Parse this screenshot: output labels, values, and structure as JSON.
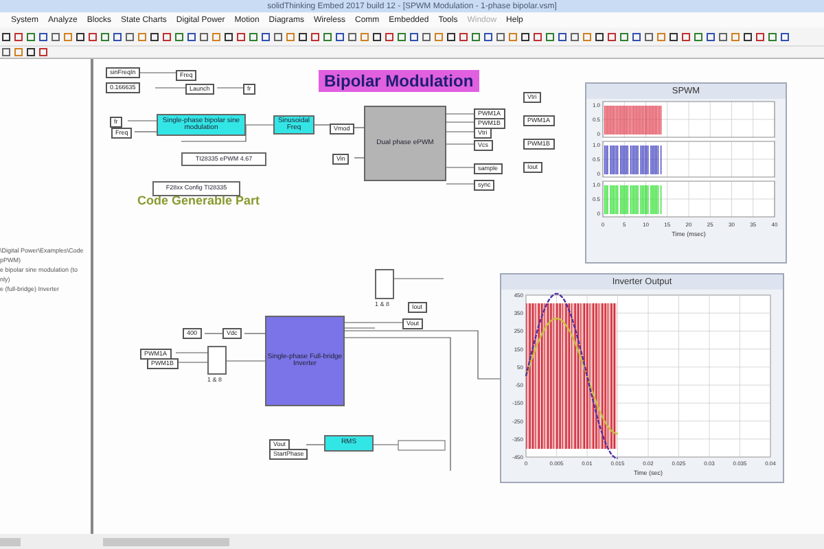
{
  "window": {
    "title": "solidThinking Embed 2017 build 12 - [SPWM Modulation - 1-phase bipolar.vsm]"
  },
  "menu": [
    {
      "label": "System",
      "disabled": false
    },
    {
      "label": "Analyze",
      "disabled": false
    },
    {
      "label": "Blocks",
      "disabled": false
    },
    {
      "label": "State Charts",
      "disabled": false
    },
    {
      "label": "Digital Power",
      "disabled": false
    },
    {
      "label": "Motion",
      "disabled": false
    },
    {
      "label": "Diagrams",
      "disabled": false
    },
    {
      "label": "Wireless",
      "disabled": false
    },
    {
      "label": "Comm",
      "disabled": false
    },
    {
      "label": "Embedded",
      "disabled": false
    },
    {
      "label": "Tools",
      "disabled": false
    },
    {
      "label": "Window",
      "disabled": true
    },
    {
      "label": "Help",
      "disabled": false
    }
  ],
  "left_panel": {
    "lines": [
      "\\Digital Power\\Examples\\Code",
      "pPWM)",
      "e bipolar sine modulation (to",
      "nly)",
      "e (full-bridge) Inverter"
    ]
  },
  "diagram": {
    "title": "Bipolar Modulation",
    "caption": "Code Generable Part",
    "blocks": [
      {
        "kind": "block",
        "text": "Single-phase bipolar sine modulation",
        "color": "#33e6e6"
      },
      {
        "kind": "block",
        "text": "Sinusoidal Freq",
        "color": "#33e6e6"
      },
      {
        "kind": "block",
        "text": "Dual phase ePWM",
        "color": "#b4b4b4"
      },
      {
        "kind": "note",
        "text": "TI28335 ePWM 4.67",
        "color": "#ffffff"
      },
      {
        "kind": "note",
        "text": "F28xx Config TI28335",
        "color": "#ffffff"
      },
      {
        "kind": "mux",
        "text": "1 & 8",
        "color": "#ffffff"
      },
      {
        "kind": "block",
        "text": "Single-phase Full-bridge Inverter",
        "color": "#7b74e8"
      },
      {
        "kind": "mux",
        "text": "1 & 8",
        "color": "#ffffff"
      },
      {
        "kind": "block",
        "text": "RMS",
        "color": "#33e6e6"
      }
    ],
    "tags": [
      "sinFreqIn",
      "Freq",
      "0.166635",
      "Launch",
      "fr",
      "fr",
      "Freq",
      "Vmod",
      "Vin",
      "Vtri",
      "PWM1A",
      "PWM1B",
      "Iout",
      "PWM1A",
      "PWM1B",
      "Vtri",
      "Vcs",
      "sample",
      "sync",
      "400",
      "Vdc",
      "PWM1A",
      "PWM1B",
      "Vout",
      "Iout",
      "Vout",
      "StartPhase"
    ]
  },
  "scopes": [
    {
      "title": "SPWM",
      "plots": [
        {
          "yticks": [
            "1.0",
            "0.5",
            "0"
          ]
        },
        {
          "yticks": [
            "1.0",
            "0.5",
            "0"
          ]
        },
        {
          "yticks": [
            "1.0",
            "0.5",
            "0"
          ]
        }
      ],
      "xticks": [
        "0",
        "5",
        "10",
        "15",
        "20",
        "25",
        "30",
        "35",
        "40"
      ],
      "xlabel": "Time (msec)"
    },
    {
      "title": "Inverter Output",
      "yticks": [
        "450",
        "350",
        "250",
        "150",
        "50",
        "-50",
        "-150",
        "-250",
        "-350",
        "-450"
      ],
      "xticks": [
        "0",
        "0.005",
        "0.01",
        "0.015",
        "0.02",
        "0.025",
        "0.03",
        "0.035",
        "0.04"
      ],
      "xlabel": "Time (sec)"
    }
  ]
}
